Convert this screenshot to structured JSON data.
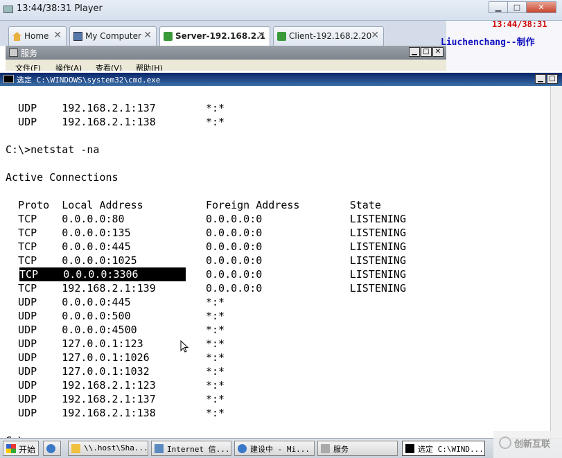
{
  "player": {
    "title": "13:44/38:31 Player",
    "btn_min": "▁",
    "btn_max": "□",
    "btn_close": "✕"
  },
  "tabs": [
    {
      "label": "Home",
      "close": "✕"
    },
    {
      "label": "My Computer",
      "close": "✕"
    },
    {
      "label": "Server-192.168.2.1",
      "close": "✕"
    },
    {
      "label": "Client-192.168.2.20",
      "close": "✕"
    }
  ],
  "overlay": {
    "time": "13:44/38:31",
    "author": "Liuchenchang--制作"
  },
  "services": {
    "title": "服务",
    "menu": [
      "文件(F)",
      "操作(A)",
      "查看(V)",
      "帮助(H)"
    ]
  },
  "cmd": {
    "title": "选定 C:\\WINDOWS\\system32\\cmd.exe",
    "lines": [
      "  UDP    192.168.2.1:137        *:*",
      "  UDP    192.168.2.1:138        *:*",
      "",
      "C:\\>netstat -na",
      "",
      "Active Connections",
      "",
      "  Proto  Local Address          Foreign Address        State",
      "  TCP    0.0.0.0:80             0.0.0.0:0              LISTENING",
      "  TCP    0.0.0.0:135            0.0.0.0:0              LISTENING",
      "  TCP    0.0.0.0:445            0.0.0.0:0              LISTENING",
      "  TCP    0.0.0.0:1025           0.0.0.0:0              LISTENING",
      "                                0.0.0.0:0              LISTENING",
      "  TCP    192.168.2.1:139        0.0.0.0:0              LISTENING",
      "  UDP    0.0.0.0:445            *:*",
      "  UDP    0.0.0.0:500            *:*",
      "  UDP    0.0.0.0:4500           *:*",
      "  UDP    127.0.0.1:123          *:*",
      "  UDP    127.0.0.1:1026         *:*",
      "  UDP    127.0.0.1:1032         *:*",
      "  UDP    192.168.2.1:123        *:*",
      "  UDP    192.168.2.1:137        *:*",
      "  UDP    192.168.2.1:138        *:*",
      "",
      "C:\\>"
    ],
    "selected_text": "TCP    0.0.0.0:3306"
  },
  "taskbar": {
    "start": "开始",
    "items": [
      "\\\\.host\\Sha...",
      "Internet 信...",
      "建设中 - Mi...",
      "服务",
      "选定 C:\\WIND..."
    ]
  },
  "logo": {
    "text": "创新互联"
  }
}
